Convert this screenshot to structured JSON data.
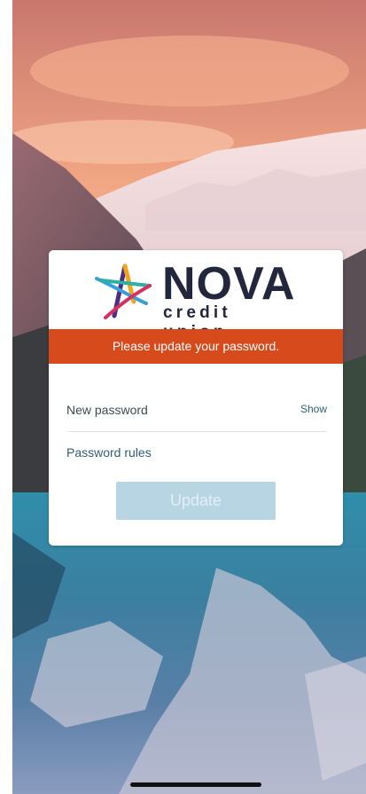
{
  "brand": {
    "name": "NOVA",
    "tagline": "credit union",
    "logo_icon": "star-logo-icon"
  },
  "banner": {
    "message": "Please update your password."
  },
  "form": {
    "new_password_placeholder": "New password",
    "new_password_value": "",
    "show_label": "Show",
    "rules_link": "Password rules",
    "update_label": "Update"
  },
  "colors": {
    "banner": "#d64a1b",
    "brand_text": "#22273d",
    "link": "#2d5f75",
    "button_disabled": "#b7d5e2"
  }
}
